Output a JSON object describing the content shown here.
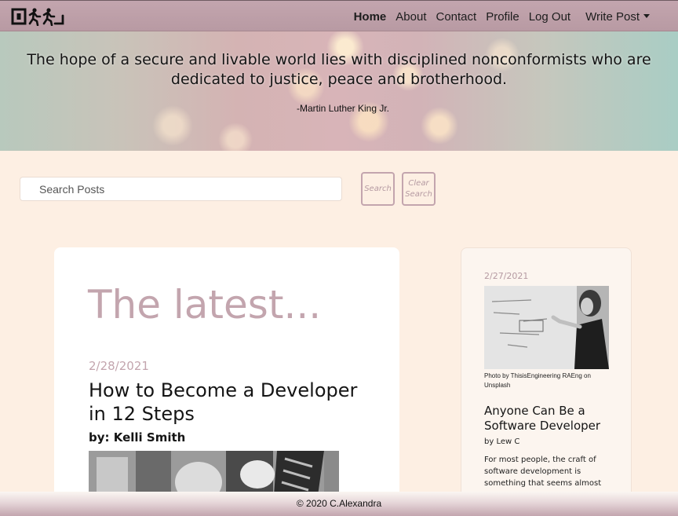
{
  "nav": {
    "logo_icon": "running-figures-logo",
    "items": [
      {
        "label": "Home"
      },
      {
        "label": "About"
      },
      {
        "label": "Contact"
      },
      {
        "label": "Profile"
      },
      {
        "label": "Log Out"
      }
    ],
    "write_post": "Write Post",
    "colors": {
      "accent": "#c3a5ae",
      "background": "#fdefe3"
    }
  },
  "hero": {
    "quote": "The hope of a secure and livable world lies with disciplined nonconformists who are dedicated to justice, peace and brotherhood.",
    "author": "-Martin Luther King Jr."
  },
  "search": {
    "placeholder": "Search Posts",
    "search_button": "Search",
    "clear_button": "Clear Search"
  },
  "main": {
    "heading": "The latest...",
    "post": {
      "date": "2/28/2021",
      "title": "How to Become a Developer in 12 Steps",
      "author": "by: Kelli Smith"
    }
  },
  "sidebar": {
    "post": {
      "date": "2/27/2021",
      "caption": "Photo by ThisisEngineering RAEng on Unsplash",
      "title": "Anyone Can Be a Software Developer",
      "author": "by Lew C",
      "excerpt": "For most people, the craft of software development is something that seems almost"
    }
  },
  "footer": {
    "text": "© 2020 C.Alexandra"
  }
}
